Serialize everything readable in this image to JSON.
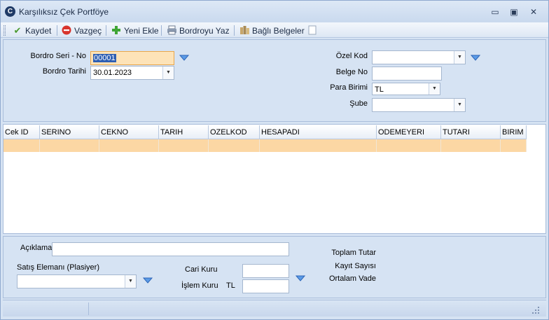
{
  "window": {
    "title": "Karşılıksız Çek Portföye",
    "app_icon": "C",
    "minimize_glyph": "▭",
    "maximize_glyph": "▣",
    "close_glyph": "✕"
  },
  "toolbar": {
    "save_label": "Kaydet",
    "cancel_label": "Vazgeç",
    "new_label": "Yeni Ekle",
    "print_label": "Bordroyu Yaz",
    "attachments_label": "Bağlı Belgeler"
  },
  "form": {
    "bordro_seri_label": "Bordro Seri - No",
    "bordro_seri_value": "00001",
    "bordro_tarihi_label": "Bordro Tarihi",
    "bordro_tarihi_value": "30.01.2023",
    "ozel_kod_label": "Özel Kod",
    "ozel_kod_value": "",
    "belge_no_label": "Belge No",
    "belge_no_value": "",
    "para_birimi_label": "Para Birimi",
    "para_birimi_value": "TL",
    "sube_label": "Şube",
    "sube_value": ""
  },
  "grid": {
    "columns": [
      "Cek ID",
      "SERINO",
      "CEKNO",
      "TARIH",
      "OZELKOD",
      "HESAPADI",
      "ODEMEYERI",
      "TUTARI",
      "BIRIM"
    ]
  },
  "footer": {
    "aciklama_label": "Açıklama",
    "aciklama_value": "",
    "satis_elemani_label": "Satış Elemanı (Plasiyer)",
    "satis_elemani_value": "",
    "cari_kuru_label": "Cari Kuru",
    "cari_kuru_value": "",
    "islem_kuru_label": "İşlem Kuru",
    "islem_kuru_currency": "TL",
    "islem_kuru_value": "",
    "toplam_tutar_label": "Toplam Tutar",
    "kayit_sayisi_label": "Kayıt Sayısı",
    "ortalam_vade_label": "Ortalam Vade"
  },
  "colors": {
    "accent": "#3a7bd5",
    "selected_row": "#fcd7a4",
    "window_bg": "#d6e3f3"
  }
}
